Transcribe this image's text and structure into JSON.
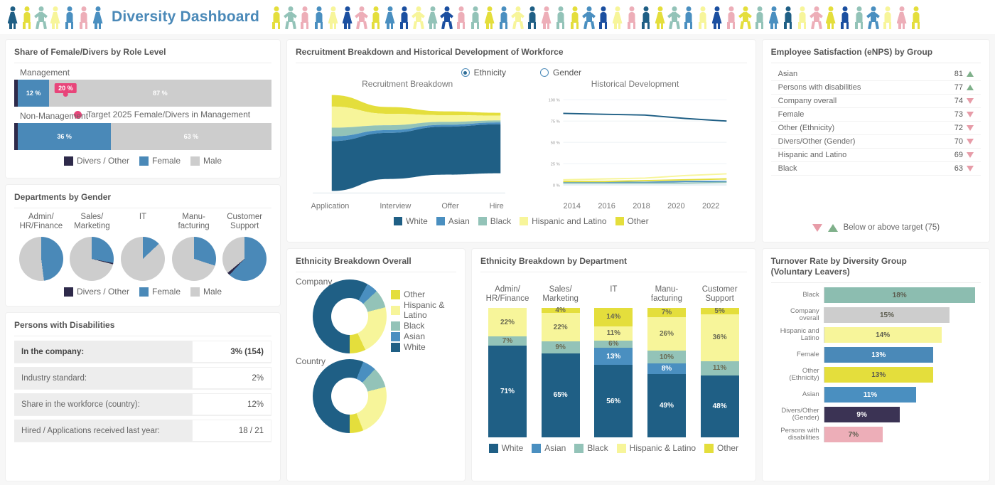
{
  "app": {
    "title": "Diversity Dashboard"
  },
  "colors": {
    "white": "#1f5f85",
    "asian": "#4a8fc0",
    "black": "#93c3b8",
    "hispanic": "#f7f59a",
    "other": "#e4de3c",
    "male": "#cdcdcd",
    "female": "#4a89b8",
    "divers": "#2e2a4a",
    "target_pink": "#e8457a",
    "up_green": "#7fb08a",
    "down_pink": "#e79ca8",
    "disability_pink": "#edaeb8",
    "accent": "#4a89b8"
  },
  "header_people": [
    {
      "color": "#1f5f85",
      "pose": "skirt"
    },
    {
      "color": "#e4de3c",
      "pose": "plain"
    },
    {
      "color": "#93c3b8",
      "pose": "arms"
    },
    {
      "color": "#f7f59a",
      "pose": "skirt"
    },
    {
      "color": "#4a8fc0",
      "pose": "plain"
    },
    {
      "color": "#edaeb8",
      "pose": "plain"
    },
    {
      "color": "#4a8fc0",
      "pose": "skirt"
    },
    {
      "color": "#e4de3c",
      "pose": "plain"
    },
    {
      "color": "#93c3b8",
      "pose": "arms"
    },
    {
      "color": "#edaeb8",
      "pose": "plain"
    },
    {
      "color": "#4a8fc0",
      "pose": "plain"
    },
    {
      "color": "#f7f59a",
      "pose": "skirt"
    },
    {
      "color": "#1b4fa0",
      "pose": "skirt"
    },
    {
      "color": "#edaeb8",
      "pose": "arms"
    },
    {
      "color": "#e4de3c",
      "pose": "plain"
    },
    {
      "color": "#4a8fc0",
      "pose": "skirt"
    },
    {
      "color": "#1b4fa0",
      "pose": "plain"
    },
    {
      "color": "#f7f59a",
      "pose": "arms"
    },
    {
      "color": "#93c3b8",
      "pose": "skirt"
    },
    {
      "color": "#1b4fa0",
      "pose": "arms"
    },
    {
      "color": "#edaeb8",
      "pose": "plain"
    },
    {
      "color": "#93c3b8",
      "pose": "plain"
    },
    {
      "color": "#e4de3c",
      "pose": "skirt"
    },
    {
      "color": "#4a8fc0",
      "pose": "plain"
    },
    {
      "color": "#f7f59a",
      "pose": "arms"
    },
    {
      "color": "#1f5f85",
      "pose": "plain"
    },
    {
      "color": "#edaeb8",
      "pose": "skirt"
    },
    {
      "color": "#93c3b8",
      "pose": "plain"
    },
    {
      "color": "#e4de3c",
      "pose": "plain"
    },
    {
      "color": "#4a8fc0",
      "pose": "arms"
    },
    {
      "color": "#1b4fa0",
      "pose": "plain"
    },
    {
      "color": "#f7f59a",
      "pose": "skirt"
    },
    {
      "color": "#edaeb8",
      "pose": "plain"
    },
    {
      "color": "#1f5f85",
      "pose": "plain"
    },
    {
      "color": "#e4de3c",
      "pose": "skirt"
    },
    {
      "color": "#93c3b8",
      "pose": "arms"
    },
    {
      "color": "#4a8fc0",
      "pose": "plain"
    },
    {
      "color": "#f7f59a",
      "pose": "plain"
    },
    {
      "color": "#1b4fa0",
      "pose": "skirt"
    },
    {
      "color": "#edaeb8",
      "pose": "plain"
    },
    {
      "color": "#e4de3c",
      "pose": "arms"
    },
    {
      "color": "#93c3b8",
      "pose": "plain"
    },
    {
      "color": "#4a8fc0",
      "pose": "skirt"
    },
    {
      "color": "#1f5f85",
      "pose": "plain"
    },
    {
      "color": "#f7f59a",
      "pose": "plain"
    },
    {
      "color": "#edaeb8",
      "pose": "arms"
    },
    {
      "color": "#e4de3c",
      "pose": "skirt"
    },
    {
      "color": "#1b4fa0",
      "pose": "plain"
    },
    {
      "color": "#93c3b8",
      "pose": "plain"
    },
    {
      "color": "#4a8fc0",
      "pose": "arms"
    },
    {
      "color": "#f7f59a",
      "pose": "plain"
    },
    {
      "color": "#edaeb8",
      "pose": "skirt"
    },
    {
      "color": "#e4de3c",
      "pose": "plain"
    }
  ],
  "role_level": {
    "title": "Share of Female/Divers by Role Level",
    "management_label": "Management",
    "nonmanagement_label": "Non-Management",
    "target_note": "Target 2025 Female/Divers in Management",
    "target_value_label": "20 %",
    "target_value": 20,
    "management": {
      "divers": 1,
      "female": 12,
      "male": 87,
      "divers_label": "",
      "female_label": "12 %",
      "male_label": "87 %"
    },
    "nonmanagement": {
      "divers": 1,
      "female": 36,
      "male": 63,
      "divers_label": "",
      "female_label": "36 %",
      "male_label": "63 %"
    },
    "legend": [
      {
        "label": "Divers / Other",
        "color": "#2e2a4a"
      },
      {
        "label": "Female",
        "color": "#4a89b8"
      },
      {
        "label": "Male",
        "color": "#cdcdcd"
      }
    ]
  },
  "departments_gender": {
    "title": "Departments by Gender",
    "legend": [
      {
        "label": "Divers / Other",
        "color": "#2e2a4a"
      },
      {
        "label": "Female",
        "color": "#4a89b8"
      },
      {
        "label": "Male",
        "color": "#cdcdcd"
      }
    ],
    "items": [
      {
        "name": "Admin/\nHR/Finance",
        "line1": "Admin/",
        "line2": "HR/Finance",
        "female": 48,
        "divers": 0,
        "male": 52
      },
      {
        "name": "Sales/Marketing",
        "line1": "Sales/",
        "line2": "Marketing",
        "female": 28,
        "divers": 1,
        "male": 71
      },
      {
        "name": "IT",
        "line1": "IT",
        "line2": "",
        "female": 13,
        "divers": 0,
        "male": 87
      },
      {
        "name": "Manufacturing",
        "line1": "Manu-",
        "line2": "facturing",
        "female": 30,
        "divers": 0,
        "male": 70
      },
      {
        "name": "Customer Support",
        "line1": "Customer",
        "line2": "Support",
        "female": 62,
        "divers": 2,
        "male": 36
      }
    ]
  },
  "disabilities": {
    "title": "Persons with Disabilities",
    "rows": [
      {
        "key": "In the company:",
        "value": "3% (154)",
        "bold": true
      },
      {
        "key": "Industry standard:",
        "value": "2%",
        "bold": false
      },
      {
        "key": "Share in the workforce (country):",
        "value": "12%",
        "bold": false
      },
      {
        "key": "Hired / Applications received last year:",
        "value": "18 / 21",
        "bold": false
      }
    ]
  },
  "recruitment": {
    "title": "Recruitment Breakdown and Historical Development of Workforce",
    "radio_ethnicity": "Ethnicity",
    "radio_gender": "Gender",
    "selected": "Ethnicity",
    "left_title": "Recruitment Breakdown",
    "right_title": "Historical Development",
    "legend": [
      {
        "label": "White",
        "color": "#1f5f85"
      },
      {
        "label": "Asian",
        "color": "#4a8fc0"
      },
      {
        "label": "Black",
        "color": "#93c3b8"
      },
      {
        "label": "Hispanic and Latino",
        "color": "#f7f59a"
      },
      {
        "label": "Other",
        "color": "#e4de3c"
      }
    ]
  },
  "ethnicity_overall": {
    "title": "Ethnicity Breakdown Overall",
    "company_label": "Company",
    "country_label": "Country",
    "legend": [
      {
        "label": "Other",
        "color": "#e4de3c"
      },
      {
        "label": "Hispanic & Latino",
        "color": "#f7f59a"
      },
      {
        "label": "Black",
        "color": "#93c3b8"
      },
      {
        "label": "Asian",
        "color": "#4a8fc0"
      },
      {
        "label": "White",
        "color": "#1f5f85"
      }
    ]
  },
  "ethnicity_departments": {
    "title": "Ethnicity Breakdown by Department",
    "legend": [
      {
        "label": "White",
        "color": "#1f5f85"
      },
      {
        "label": "Asian",
        "color": "#4a8fc0"
      },
      {
        "label": "Black",
        "color": "#93c3b8"
      },
      {
        "label": "Hispanic & Latino",
        "color": "#f7f59a"
      },
      {
        "label": "Other",
        "color": "#e4de3c"
      }
    ]
  },
  "enps": {
    "title": "Employee Satisfaction (eNPS) by Group",
    "footer": "Below or above target (75)",
    "rows": [
      {
        "label": "Asian",
        "value": "81",
        "dir": "up"
      },
      {
        "label": "Persons with disabilities",
        "value": "77",
        "dir": "up"
      },
      {
        "label": "Company overall",
        "value": "74",
        "dir": "down"
      },
      {
        "label": "Female",
        "value": "73",
        "dir": "down"
      },
      {
        "label": "Other (Ethnicity)",
        "value": "72",
        "dir": "down"
      },
      {
        "label": "Divers/Other (Gender)",
        "value": "70",
        "dir": "down"
      },
      {
        "label": "Hispanic and Latino",
        "value": "69",
        "dir": "down"
      },
      {
        "label": "Black",
        "value": "63",
        "dir": "down"
      }
    ]
  },
  "turnover": {
    "title_line1": "Turnover Rate by Diversity Group",
    "title_line2": "(Voluntary Leavers)"
  },
  "chart_data": [
    {
      "type": "bar",
      "title": "Share of Female/Divers by Role Level",
      "orientation": "horizontal-stacked",
      "categories": [
        "Management",
        "Non-Management"
      ],
      "series": [
        {
          "name": "Divers / Other",
          "values": [
            1,
            1
          ],
          "color": "#2e2a4a"
        },
        {
          "name": "Female",
          "values": [
            12,
            36
          ],
          "color": "#4a89b8"
        },
        {
          "name": "Male",
          "values": [
            87,
            63
          ],
          "color": "#cdcdcd"
        }
      ],
      "annotations": [
        {
          "label": "Target 2025 Female/Divers in Management",
          "value": 20
        }
      ],
      "xlim": [
        0,
        100
      ],
      "ylabel": "",
      "xlabel": "%"
    },
    {
      "type": "pie",
      "title": "Departments by Gender",
      "categories": [
        "Admin/HR/Finance",
        "Sales/Marketing",
        "IT",
        "Manufacturing",
        "Customer Support"
      ],
      "series": [
        {
          "name": "Female",
          "values": [
            48,
            28,
            13,
            30,
            62
          ],
          "color": "#4a89b8"
        },
        {
          "name": "Divers / Other",
          "values": [
            0,
            1,
            0,
            0,
            2
          ],
          "color": "#2e2a4a"
        },
        {
          "name": "Male",
          "values": [
            52,
            71,
            87,
            70,
            36
          ],
          "color": "#cdcdcd"
        }
      ]
    },
    {
      "type": "area",
      "title": "Recruitment Breakdown",
      "categories": [
        "Application",
        "Interview",
        "Offer",
        "Hire"
      ],
      "ylim": [
        0,
        100
      ],
      "yticks": [
        "0 %",
        "25 %",
        "50 %",
        "75 %",
        "100 %"
      ],
      "series": [
        {
          "name": "White",
          "values": [
            52,
            48,
            50,
            51
          ],
          "color": "#1f5f85"
        },
        {
          "name": "Asian",
          "values": [
            5,
            3,
            2,
            2
          ],
          "color": "#4a8fc0"
        },
        {
          "name": "Black",
          "values": [
            9,
            5,
            3,
            2
          ],
          "color": "#93c3b8"
        },
        {
          "name": "Hispanic and Latino",
          "values": [
            22,
            12,
            7,
            5
          ],
          "color": "#f7f59a"
        },
        {
          "name": "Other",
          "values": [
            12,
            7,
            4,
            3
          ],
          "color": "#e4de3c"
        }
      ],
      "note": "Funnel widths taper from Application to Hire"
    },
    {
      "type": "line",
      "title": "Historical Development",
      "x": [
        2014,
        2016,
        2018,
        2020,
        2022
      ],
      "xticks": [
        "2014",
        "2016",
        "2018",
        "2020",
        "2022"
      ],
      "ylim": [
        0,
        100
      ],
      "yticks": [
        "0 %",
        "25 %",
        "50 %",
        "75 %",
        "100 %"
      ],
      "series": [
        {
          "name": "White",
          "values": [
            84,
            83,
            82,
            78,
            75
          ],
          "color": "#1f5f85"
        },
        {
          "name": "Asian",
          "values": [
            3,
            3,
            3,
            4,
            4
          ],
          "color": "#4a8fc0"
        },
        {
          "name": "Black",
          "values": [
            2,
            2,
            2,
            2,
            3
          ],
          "color": "#93c3b8"
        },
        {
          "name": "Hispanic and Latino",
          "values": [
            6,
            7,
            8,
            11,
            13
          ],
          "color": "#f7f59a"
        },
        {
          "name": "Other",
          "values": [
            4,
            4,
            5,
            6,
            7
          ],
          "color": "#e4de3c"
        }
      ]
    },
    {
      "type": "pie",
      "title": "Ethnicity Breakdown Overall",
      "categories": [
        "Company",
        "Country"
      ],
      "series": [
        {
          "name": "White",
          "values": [
            58,
            56
          ],
          "color": "#1f5f85"
        },
        {
          "name": "Asian",
          "values": [
            5,
            6
          ],
          "color": "#4a8fc0"
        },
        {
          "name": "Black",
          "values": [
            8,
            9
          ],
          "color": "#93c3b8"
        },
        {
          "name": "Hispanic & Latino",
          "values": [
            22,
            23
          ],
          "color": "#f7f59a"
        },
        {
          "name": "Other",
          "values": [
            7,
            6
          ],
          "color": "#e4de3c"
        }
      ]
    },
    {
      "type": "bar",
      "title": "Ethnicity Breakdown by Department",
      "orientation": "vertical-stacked",
      "categories": [
        "Admin/HR/Finance",
        "Sales/Marketing",
        "IT",
        "Manufacturing",
        "Customer Support"
      ],
      "series": [
        {
          "name": "White",
          "values": [
            71,
            65,
            56,
            49,
            48
          ],
          "color": "#1f5f85"
        },
        {
          "name": "Asian",
          "values": [
            0,
            0,
            13,
            8,
            0
          ],
          "color": "#4a8fc0"
        },
        {
          "name": "Black",
          "values": [
            7,
            9,
            6,
            10,
            11
          ],
          "color": "#93c3b8"
        },
        {
          "name": "Hispanic & Latino",
          "values": [
            22,
            22,
            11,
            26,
            36
          ],
          "color": "#f7f59a"
        },
        {
          "name": "Other",
          "values": [
            0,
            4,
            14,
            7,
            5
          ],
          "color": "#e4de3c"
        }
      ],
      "ylim": [
        0,
        100
      ]
    },
    {
      "type": "table",
      "title": "Employee Satisfaction (eNPS) by Group",
      "columns": [
        "Group",
        "eNPS"
      ],
      "rows": [
        [
          "Asian",
          81
        ],
        [
          "Persons with disabilities",
          77
        ],
        [
          "Company overall",
          74
        ],
        [
          "Female",
          73
        ],
        [
          "Other (Ethnicity)",
          72
        ],
        [
          "Divers/Other (Gender)",
          70
        ],
        [
          "Hispanic and Latino",
          69
        ],
        [
          "Black",
          63
        ]
      ],
      "target": 75
    },
    {
      "type": "bar",
      "title": "Turnover Rate by Diversity Group (Voluntary Leavers)",
      "orientation": "horizontal",
      "categories": [
        "Black",
        "Company overall",
        "Hispanic and Latino",
        "Female",
        "Other (Ethnicity)",
        "Asian",
        "Divers/Other (Gender)",
        "Persons with disabilities"
      ],
      "values": [
        18,
        15,
        14,
        13,
        13,
        11,
        9,
        7
      ],
      "labels": [
        "18%",
        "15%",
        "14%",
        "13%",
        "13%",
        "11%",
        "9%",
        "7%"
      ],
      "colors": [
        "#8cbdb0",
        "#cdcdcd",
        "#f7f59a",
        "#4a89b8",
        "#e4de3c",
        "#4a8fc0",
        "#3b3354",
        "#edaeb8"
      ],
      "xlim": [
        0,
        20
      ]
    }
  ]
}
